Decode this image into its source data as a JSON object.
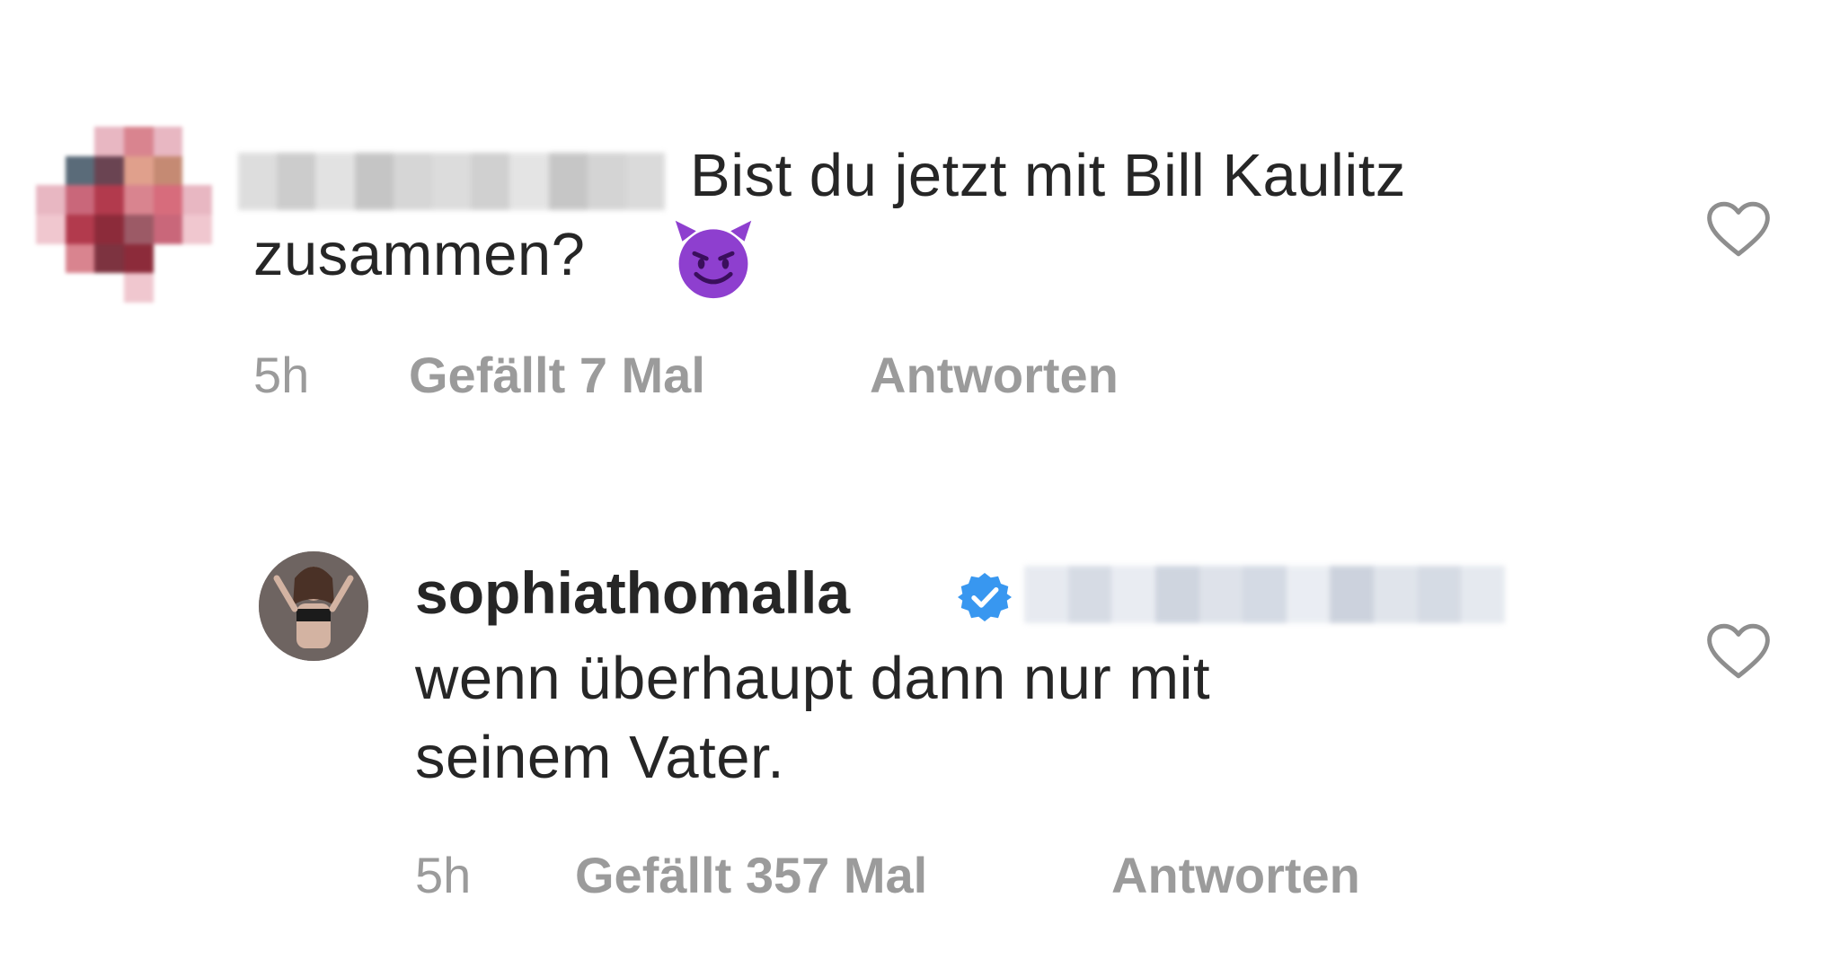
{
  "comments": [
    {
      "username": "",
      "text_line1": "Bist du jetzt mit Bill Kaulitz",
      "text_line2": "zusammen?",
      "emoji_icon": "smiling-devil-emoji",
      "time": "5h",
      "likes_label": "Gefällt 7 Mal",
      "reply_label": "Antworten",
      "like_icon": "heart-outline-icon"
    },
    {
      "username": "sophiathomalla",
      "verified": true,
      "verified_icon": "verified-badge-icon",
      "accent_color": "#3897f0",
      "text_line1": "wenn überhaupt dann nur mit",
      "text_line2": "seinem Vater.",
      "time": "5h",
      "likes_label": "Gefällt 357 Mal",
      "reply_label": "Antworten",
      "like_icon": "heart-outline-icon"
    }
  ],
  "colors": {
    "text": "#262626",
    "meta": "#9b9b9b",
    "verified": "#3897f0"
  }
}
